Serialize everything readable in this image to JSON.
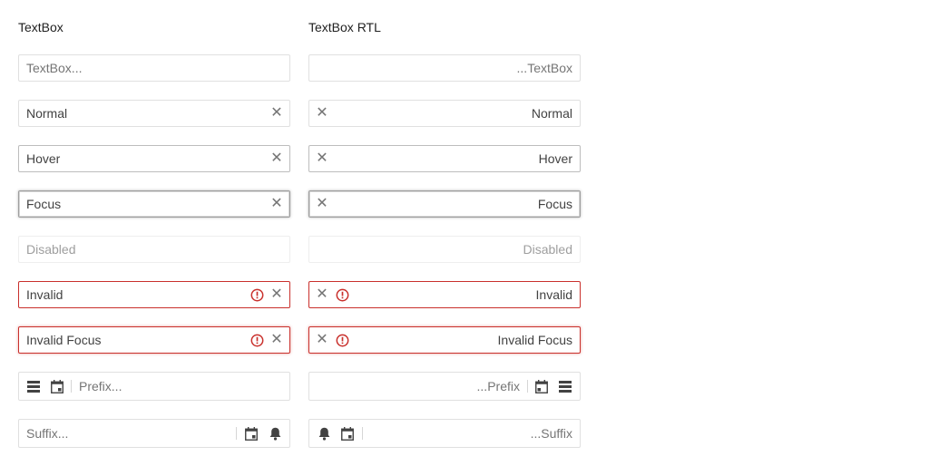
{
  "columns": [
    {
      "heading": "TextBox"
    },
    {
      "heading": "TextBox RTL"
    }
  ],
  "ltr": {
    "empty_placeholder": "TextBox...",
    "normal": "Normal",
    "hover": "Hover",
    "focus": "Focus",
    "disabled": "Disabled",
    "invalid": "Invalid",
    "invalid_focus": "Invalid Focus",
    "prefix_placeholder": "Prefix...",
    "suffix_placeholder": "Suffix..."
  },
  "rtl": {
    "empty_placeholder": "...TextBox",
    "normal": "Normal",
    "hover": "Hover",
    "focus": "Focus",
    "disabled": "Disabled",
    "invalid": "Invalid",
    "invalid_focus": "Invalid Focus",
    "prefix_placeholder": "...Prefix",
    "suffix_placeholder": "...Suffix"
  },
  "icons": {
    "clear": "close-icon",
    "error": "exclamation-circle-icon",
    "menu": "menu-icon",
    "calendar": "calendar-icon",
    "bell": "bell-icon"
  },
  "colors": {
    "error": "#c9302c",
    "border": "#e0e0e0",
    "text": "#424242",
    "placeholder": "#757575"
  }
}
